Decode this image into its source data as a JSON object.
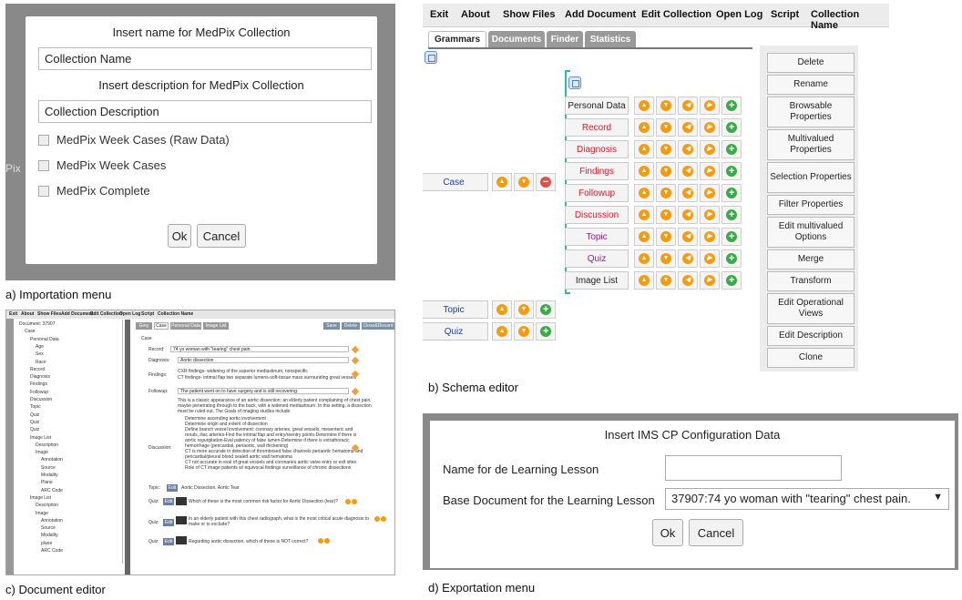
{
  "panel_a": {
    "title_name": "Insert name for MedPix Collection",
    "name_value": "Collection Name",
    "title_desc": "Insert description for MedPix Collection",
    "desc_value": "Collection Description",
    "checkboxes": [
      "MedPix Week Cases (Raw Data)",
      "MedPix Week Cases",
      "MedPix Complete"
    ],
    "background_text": "Pix",
    "ok_label": "Ok",
    "cancel_label": "Cancel",
    "caption": "a) Importation menu"
  },
  "panel_b": {
    "menu": [
      "Exit",
      "About",
      "Show Files",
      "Add Document",
      "Edit Collection",
      "Open Log",
      "Script",
      "Collection Name"
    ],
    "tabs": [
      "Grammars",
      "Documents",
      "Finder",
      "Statistics"
    ],
    "case_label": "Case",
    "children": [
      {
        "label": "Personal Data",
        "color": "#222222"
      },
      {
        "label": "Record",
        "color": "#d0202a"
      },
      {
        "label": "Diagnosis",
        "color": "#d0202a"
      },
      {
        "label": "Findings",
        "color": "#d0202a"
      },
      {
        "label": "Followup",
        "color": "#d0202a"
      },
      {
        "label": "Discussion",
        "color": "#d0202a"
      },
      {
        "label": "Topic",
        "color": "#8e1f8e"
      },
      {
        "label": "Quiz",
        "color": "#8e1f8e"
      },
      {
        "label": "Image List",
        "color": "#222222"
      }
    ],
    "topic_label": "Topic",
    "quiz_label": "Quiz",
    "side_buttons": [
      "Delete",
      "Rename",
      "Browsable Properties",
      "Multivalued Properties",
      "Selection Properties",
      "Filter Properties",
      "Edit multivalued Options",
      "Merge",
      "Transform",
      "Edit Operational Views",
      "Edit Description",
      "Clone"
    ],
    "caption": "b) Schema editor"
  },
  "panel_c": {
    "menu": [
      "Exit",
      "About",
      "Show Files",
      "Add Document",
      "Edit Collection",
      "Open Log",
      "Script",
      "Collection Name"
    ],
    "tree": [
      "Document: 37907",
      "Case",
      "Personal Data",
      "Age",
      "Sex",
      "Race",
      "Record",
      "Diagnosis",
      "Findings",
      "Followup",
      "Discussion",
      "Topic",
      "Quiz",
      "Quiz",
      "Quiz",
      "Image List",
      "Description",
      "Image",
      "Annotation",
      "Source",
      "Modality",
      "Plane",
      "ARC Code",
      "Image List",
      "Description",
      "Image",
      "Annotation",
      "Source",
      "Modality",
      "plane",
      "ARC Code"
    ],
    "tabs": [
      "Grey",
      "Case",
      "Personal Data",
      "Image List"
    ],
    "top_buttons": [
      "Save",
      "Delete",
      "Close&Discard"
    ],
    "record_label": "Record:",
    "record_value": "74 yo woman with \"tearing\" chest pain.",
    "diagnosis_label": "Diagnosis:",
    "diagnosis_value": "Aortic dissection",
    "findings_label": "Findings:",
    "findings": [
      "CXR findings- widening of the superior mediastinum, nonspecific",
      "CT findings- intimal flap two separate lumens-soft-tissue mass surrounding great vessels"
    ],
    "followup_label": "Followup:",
    "followup_value": "The patient went on to have surgery and is still recovering.",
    "followup_text": [
      "This is a classic appearance of an aortic dissection: an elderly patient complaining of chest pain,",
      "maybe penetrating through to the back, with a widened mediastinum. In this setting, a dissection",
      "must be ruled out. The Goals of imaging studies include:"
    ],
    "discussion_label": "Discussion:",
    "discussion": [
      "Determine ascending aortic involvement",
      "Determine origin and extent of dissection",
      "Define branch vessel involvement: coronary arteries, great vessels, mesenteric and",
      "renals, iliac arteries-Find the intimal flap and entry/reentry points-Determine if there is",
      "aortic regurgitation-Eval patency of false lumen-Determine if there is extrathoracic",
      "hemorrhage (pericardial, periaortic, wall thickening)",
      "CT is more accurate in detection of thrombosed false channels periaortic hematoma and",
      "pericardial/pleural blood sealed aortic wall hematoma",
      "CT not accurate in eval of great vessels and coronaries aortic valve entry or exit sites",
      "Role of CT image patients w/ equivocal findings surveillance of chronic dissections"
    ],
    "topic_label": "Topic:",
    "topic_value": "Aortic Dissection, Aortic Tear",
    "quiz_label": "Quiz:",
    "edit_label": "Edit",
    "quizzes": [
      "Which of these is the most common risk factor for Aortic Dissection (tear)?",
      "In an elderly patient with this chest radiograph, what is the most critical acute diagnosis to make or to exclude?",
      "Regarding aortic dissection, which of these is NOT correct?"
    ],
    "caption": "c) Document editor"
  },
  "panel_d": {
    "title": "Insert IMS CP Configuration Data",
    "name_label": "Name for de Learning Lesson",
    "name_value": "",
    "base_label": "Base Document for the Learning Lesson",
    "base_value": "37907:74 yo woman with \"tearing\" chest pain.",
    "ok_label": "Ok",
    "cancel_label": "Cancel",
    "caption": "d) Exportation menu"
  }
}
